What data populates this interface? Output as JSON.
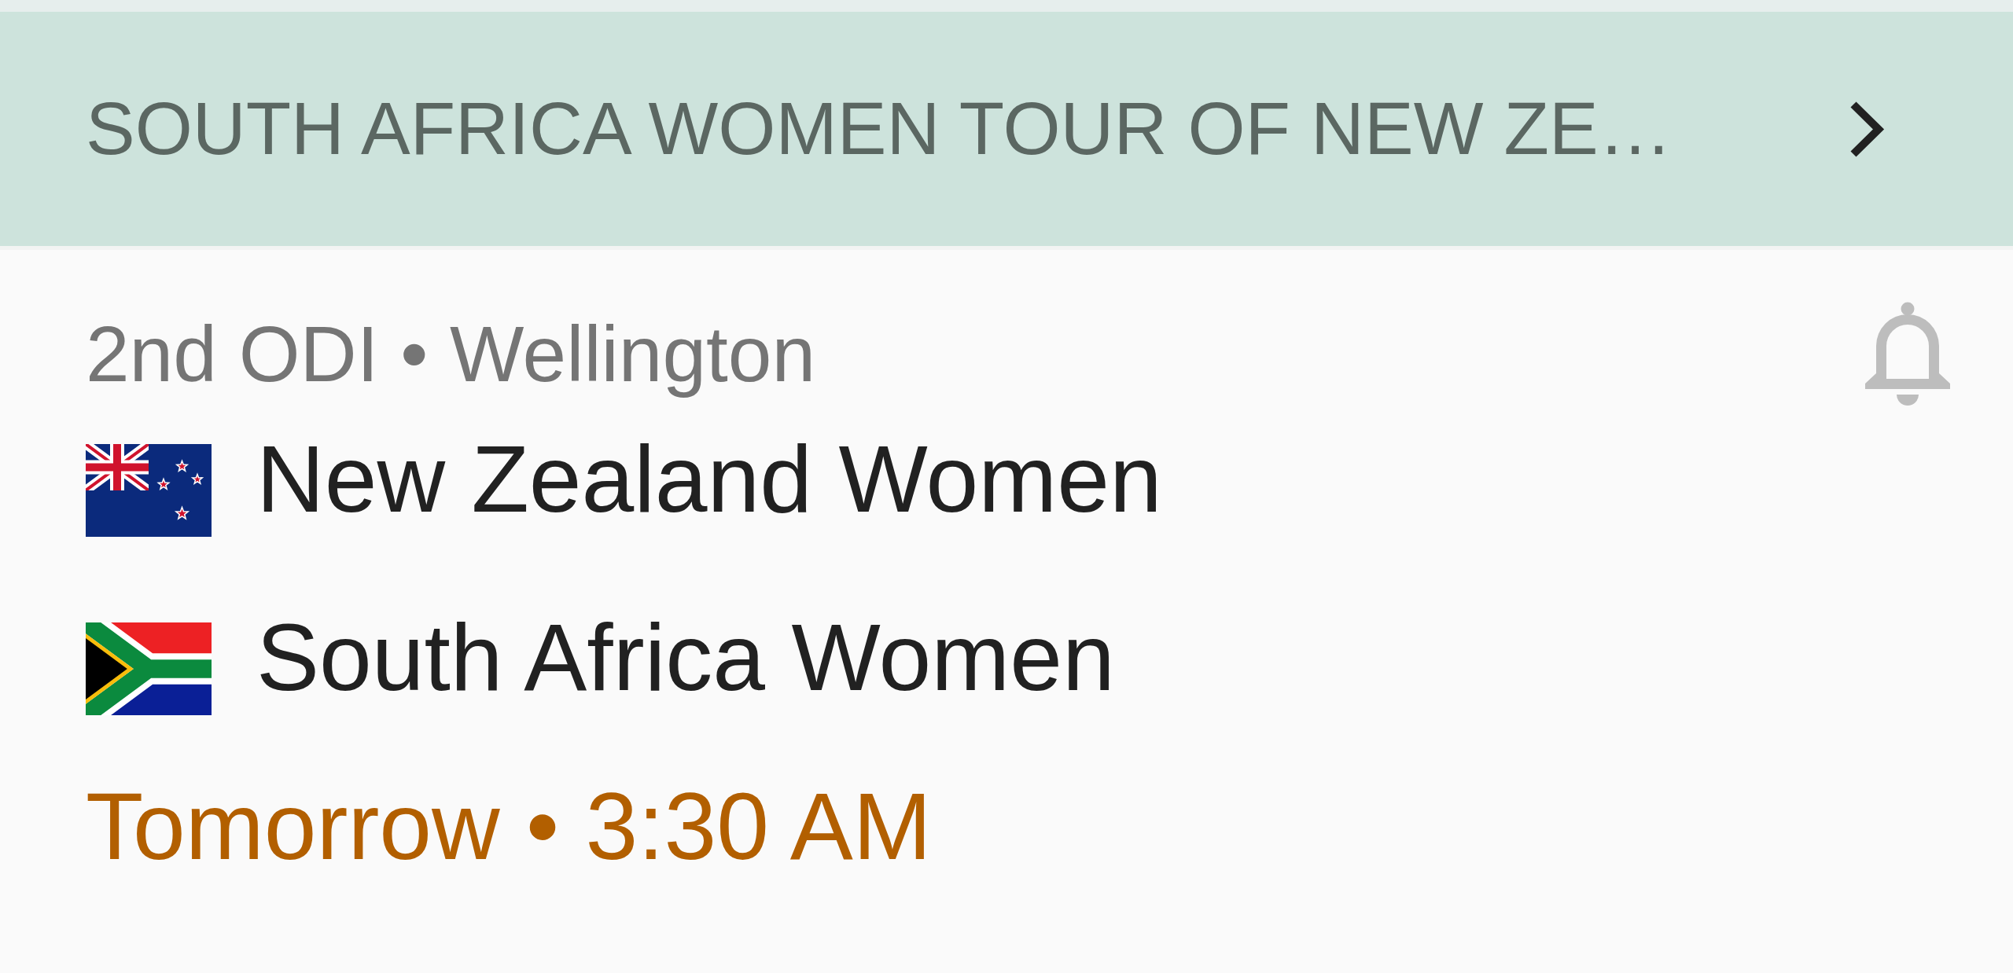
{
  "series_header": {
    "title": "SOUTH AFRICA WOMEN TOUR OF NEW ZE…"
  },
  "match": {
    "description": "2nd ODI • Wellington",
    "alerts_on": false,
    "teams": [
      {
        "name": "New Zealand Women",
        "kind": "nz"
      },
      {
        "name": "South Africa Women",
        "kind": "za"
      }
    ],
    "start_time": "Tomorrow • 3:30 AM"
  }
}
